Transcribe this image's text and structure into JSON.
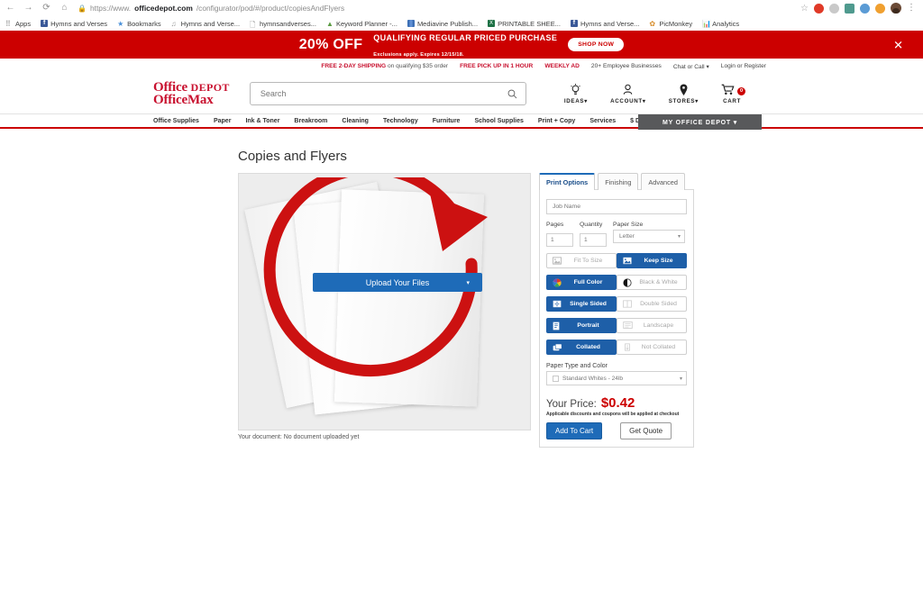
{
  "browser": {
    "nav": {
      "back": "←",
      "forward": "→",
      "reload": "C",
      "home": "⌂"
    },
    "url": {
      "lock_icon": "lock-icon",
      "scheme": "https://www.",
      "host": "officedepot.com",
      "path": "/configurator/pod/#/product/copiesAndFlyers"
    },
    "toolbar_icons": [
      "star-icon",
      "extension-red-icon",
      "extension-gray-icon",
      "extension-teal-icon",
      "extension-pin-icon",
      "extension-orange-icon",
      "profile-avatar-icon",
      "chrome-menu-icon"
    ],
    "bookmarks": [
      {
        "label": "Apps",
        "icon": "apps-grid-icon"
      },
      {
        "label": "Hymns and Verses",
        "icon": "facebook-icon"
      },
      {
        "label": "Bookmarks",
        "icon": "star-icon"
      },
      {
        "label": "Hymns and Verse...",
        "icon": "music-note-icon"
      },
      {
        "label": "hymnsandverses...",
        "icon": "document-icon"
      },
      {
        "label": "Keyword Planner -...",
        "icon": "google-ads-icon"
      },
      {
        "label": "Mediavine Publish...",
        "icon": "mediavine-icon"
      },
      {
        "label": "PRINTABLE SHEE...",
        "icon": "excel-icon"
      },
      {
        "label": "Hymns and Verse...",
        "icon": "facebook-icon"
      },
      {
        "label": "PicMonkey",
        "icon": "picmonkey-icon"
      },
      {
        "label": "Analytics",
        "icon": "analytics-icon"
      }
    ]
  },
  "promo": {
    "percent": "20% OFF",
    "headline": "QUALIFYING REGULAR PRICED PURCHASE",
    "fineprint": "Exclusions apply. Expires 12/15/18.",
    "shop_now_label": "SHOP NOW",
    "close_label": "✕",
    "background_color": "#cc0000"
  },
  "header": {
    "utility": [
      {
        "strong": "FREE 2-DAY SHIPPING",
        "thin": " on qualifying $35 order"
      },
      {
        "strong": "FREE PICK UP IN 1 HOUR",
        "thin": ""
      },
      {
        "strong": "WEEKLY AD",
        "thin": ""
      }
    ],
    "utility_plain": [
      "20+ Employee Businesses",
      "Chat or Call ▾",
      "Login or Register"
    ],
    "logo": {
      "line1_a": "Office ",
      "line1_b": "DEPOT",
      "line2": "OfficeMax",
      "color": "#c8102e"
    },
    "search": {
      "placeholder": "Search",
      "value": "",
      "icon": "search-icon"
    },
    "actions": [
      {
        "label": "IDEAS",
        "caret": "▾",
        "icon": "lightbulb-icon",
        "glyph": "☀"
      },
      {
        "label": "ACCOUNT",
        "caret": "▾",
        "icon": "user-icon",
        "glyph": "♟"
      },
      {
        "label": "STORES",
        "caret": "▾",
        "icon": "location-pin-icon",
        "glyph": "⚑"
      },
      {
        "label": "CART",
        "caret": "",
        "icon": "shopping-cart-icon",
        "glyph": "⛟",
        "badge": "0"
      }
    ],
    "nav": [
      "Office Supplies",
      "Paper",
      "Ink & Toner",
      "Breakroom",
      "Cleaning",
      "Technology",
      "Furniture",
      "School Supplies",
      "Print + Copy",
      "Services",
      "$ Deals"
    ],
    "my_office_depot": "MY OFFICE DEPOT ▾"
  },
  "page": {
    "title": "Copies and Flyers",
    "preview": {
      "upload_button_label": "Upload Your Files",
      "upload_caret": "▾",
      "annotation_icon": "red-circle-arrow-annotation",
      "doc_status": "Your document: No document uploaded yet"
    },
    "options": {
      "tabs": [
        {
          "label": "Print Options",
          "active": true
        },
        {
          "label": "Finishing",
          "active": false
        },
        {
          "label": "Advanced",
          "active": false
        }
      ],
      "job_name": {
        "placeholder": "Job Name",
        "value": ""
      },
      "fields": [
        {
          "label": "Pages",
          "value": "1"
        },
        {
          "label": "Quantity",
          "value": "1"
        }
      ],
      "paper_size": {
        "label": "Paper Size",
        "value": "Letter",
        "caret": "▾"
      },
      "toggles": [
        {
          "left": {
            "label": "Fit To Size",
            "selected": false,
            "icon": "image-fit-icon"
          },
          "right": {
            "label": "Keep Size",
            "selected": true,
            "icon": "image-keep-icon"
          }
        },
        {
          "left": {
            "label": "Full Color",
            "selected": true,
            "icon": "color-wheel-icon"
          },
          "right": {
            "label": "Black & White",
            "selected": false,
            "icon": "half-circle-icon"
          }
        },
        {
          "left": {
            "label": "Single Sided",
            "selected": true,
            "icon": "single-page-icon"
          },
          "right": {
            "label": "Double Sided",
            "selected": false,
            "icon": "double-page-icon"
          }
        },
        {
          "left": {
            "label": "Portrait",
            "selected": true,
            "icon": "portrait-page-icon"
          },
          "right": {
            "label": "Landscape",
            "selected": false,
            "icon": "landscape-page-icon"
          }
        },
        {
          "left": {
            "label": "Collated",
            "selected": true,
            "icon": "collated-stack-icon"
          },
          "right": {
            "label": "Not Collated",
            "selected": false,
            "icon": "not-collated-icon"
          }
        }
      ],
      "paper_type": {
        "label": "Paper Type and Color",
        "value": "Standard Whites - 24lb",
        "caret": "▾",
        "swatch": "#ffffff"
      },
      "price": {
        "label": "Your Price:",
        "value": "$0.42",
        "color": "#cc0000",
        "note": "Applicable discounts and coupons will be applied at checkout"
      },
      "add_to_cart_label": "Add To Cart",
      "get_quote_label": "Get Quote"
    }
  }
}
